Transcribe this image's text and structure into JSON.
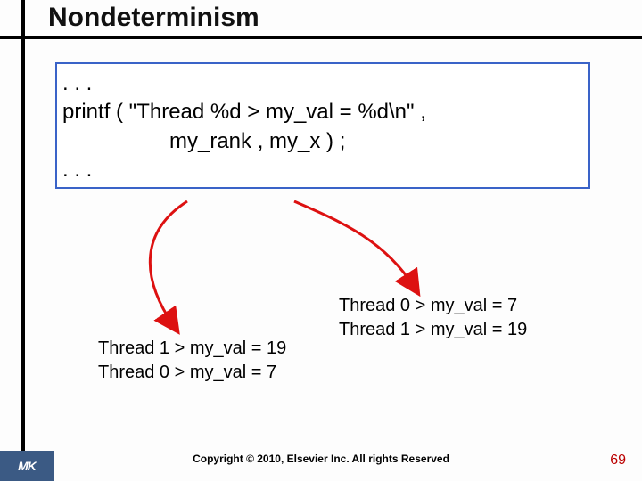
{
  "title": "Nondeterminism",
  "code": {
    "l1": ". . .",
    "l2": "printf ( \"Thread %d > my_val = %d\\n\" ,",
    "l3": "my_rank , my_x ) ;",
    "l4": ". . ."
  },
  "output_left": {
    "l1": "Thread 1 > my_val = 19",
    "l2": "Thread 0 > my_val = 7"
  },
  "output_right": {
    "l1": "Thread 0 > my_val = 7",
    "l2": "Thread 1 > my_val = 19"
  },
  "footer": {
    "copyright": "Copyright © 2010, Elsevier Inc. All rights Reserved",
    "page": "69",
    "logo": "MK"
  }
}
